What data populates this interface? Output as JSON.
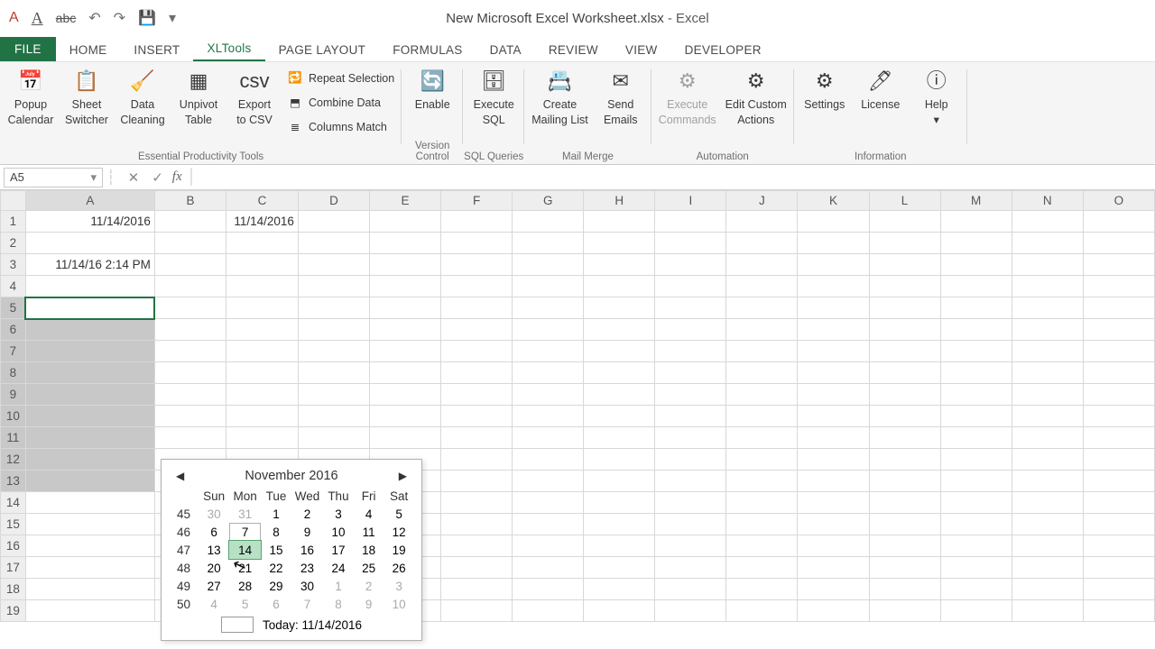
{
  "title": {
    "doc": "New Microsoft Excel Worksheet.xlsx",
    "app": "Excel"
  },
  "qat": {
    "undo_icon": "↶",
    "redo_icon": "↷",
    "save_icon": "💾",
    "expand_icon": "▾",
    "a_underline": "A",
    "strike": "abc",
    "colorA_icon": "A"
  },
  "tabs": [
    "FILE",
    "HOME",
    "INSERT",
    "XLTools",
    "PAGE LAYOUT",
    "FORMULAS",
    "DATA",
    "REVIEW",
    "VIEW",
    "DEVELOPER"
  ],
  "active_tab_index": 3,
  "ribbon": {
    "groups": [
      {
        "label": "Essential Productivity Tools",
        "big": [
          {
            "name": "popup-calendar",
            "icon": "📅",
            "line1": "Popup",
            "line2": "Calendar"
          },
          {
            "name": "sheet-switcher",
            "icon": "📋",
            "line1": "Sheet",
            "line2": "Switcher"
          },
          {
            "name": "data-cleaning",
            "icon": "🧹",
            "line1": "Data",
            "line2": "Cleaning"
          },
          {
            "name": "unpivot-table",
            "icon": "▦",
            "line1": "Unpivot",
            "line2": "Table"
          },
          {
            "name": "export-csv",
            "icon": "csv",
            "line1": "Export",
            "line2": "to CSV"
          }
        ],
        "small": [
          {
            "name": "repeat-selection",
            "icon": "🔁",
            "label": "Repeat Selection"
          },
          {
            "name": "combine-data",
            "icon": "⬒",
            "label": "Combine Data"
          },
          {
            "name": "columns-match",
            "icon": "≣",
            "label": "Columns Match"
          }
        ]
      },
      {
        "label": "Version Control",
        "big": [
          {
            "name": "vc-enable",
            "icon": "🔄",
            "line1": "Enable",
            "line2": ""
          }
        ]
      },
      {
        "label": "SQL Queries",
        "big": [
          {
            "name": "execute-sql",
            "icon": "🗄",
            "line1": "Execute",
            "line2": "SQL"
          }
        ]
      },
      {
        "label": "Mail Merge",
        "big": [
          {
            "name": "create-mailing",
            "icon": "📇",
            "line1": "Create",
            "line2": "Mailing List"
          },
          {
            "name": "send-emails",
            "icon": "✉",
            "line1": "Send",
            "line2": "Emails"
          }
        ]
      },
      {
        "label": "Automation",
        "big": [
          {
            "name": "execute-commands",
            "icon": "⚙",
            "line1": "Execute",
            "line2": "Commands",
            "disabled": true
          },
          {
            "name": "edit-actions",
            "icon": "⚙",
            "line1": "Edit Custom",
            "line2": "Actions"
          }
        ]
      },
      {
        "label": "Information",
        "big": [
          {
            "name": "settings",
            "icon": "⚙",
            "line1": "Settings",
            "line2": ""
          },
          {
            "name": "license",
            "icon": "🖊",
            "line1": "License",
            "line2": ""
          },
          {
            "name": "help",
            "icon": "ⓘ",
            "line1": "Help",
            "line2": "▾"
          }
        ]
      }
    ]
  },
  "formula_bar": {
    "namebox": "A5",
    "fx": "fx"
  },
  "columns": [
    "A",
    "B",
    "C",
    "D",
    "E",
    "F",
    "G",
    "H",
    "I",
    "J",
    "K",
    "L",
    "M",
    "N",
    "O"
  ],
  "col_widths": {
    "A": 144,
    "default": 80
  },
  "rows": 19,
  "cells": {
    "A1": "11/14/2016",
    "C1": "11/14/2016",
    "A3": "11/14/16 2:14 PM"
  },
  "selection": {
    "active": "A5",
    "range_start_row": 5,
    "range_end_row": 13,
    "col": "A"
  },
  "calendar": {
    "title": "November 2016",
    "dow": [
      "Sun",
      "Mon",
      "Tue",
      "Wed",
      "Thu",
      "Fri",
      "Sat"
    ],
    "weeks": [
      {
        "no": 45,
        "days": [
          {
            "d": 30,
            "dim": true
          },
          {
            "d": 31,
            "dim": true
          },
          {
            "d": 1
          },
          {
            "d": 2
          },
          {
            "d": 3
          },
          {
            "d": 4
          },
          {
            "d": 5
          }
        ]
      },
      {
        "no": 46,
        "days": [
          {
            "d": 6
          },
          {
            "d": 7,
            "hover": true
          },
          {
            "d": 8
          },
          {
            "d": 9
          },
          {
            "d": 10
          },
          {
            "d": 11
          },
          {
            "d": 12
          }
        ]
      },
      {
        "no": 47,
        "days": [
          {
            "d": 13
          },
          {
            "d": 14,
            "today": true
          },
          {
            "d": 15
          },
          {
            "d": 16
          },
          {
            "d": 17
          },
          {
            "d": 18
          },
          {
            "d": 19
          }
        ]
      },
      {
        "no": 48,
        "days": [
          {
            "d": 20
          },
          {
            "d": 21
          },
          {
            "d": 22
          },
          {
            "d": 23
          },
          {
            "d": 24
          },
          {
            "d": 25
          },
          {
            "d": 26
          }
        ]
      },
      {
        "no": 49,
        "days": [
          {
            "d": 27
          },
          {
            "d": 28
          },
          {
            "d": 29
          },
          {
            "d": 30
          },
          {
            "d": 1,
            "dim": true
          },
          {
            "d": 2,
            "dim": true
          },
          {
            "d": 3,
            "dim": true
          }
        ]
      },
      {
        "no": 50,
        "days": [
          {
            "d": 4,
            "dim": true
          },
          {
            "d": 5,
            "dim": true
          },
          {
            "d": 6,
            "dim": true
          },
          {
            "d": 7,
            "dim": true
          },
          {
            "d": 8,
            "dim": true
          },
          {
            "d": 9,
            "dim": true
          },
          {
            "d": 10,
            "dim": true
          }
        ]
      }
    ],
    "footer": "Today: 11/14/2016"
  }
}
